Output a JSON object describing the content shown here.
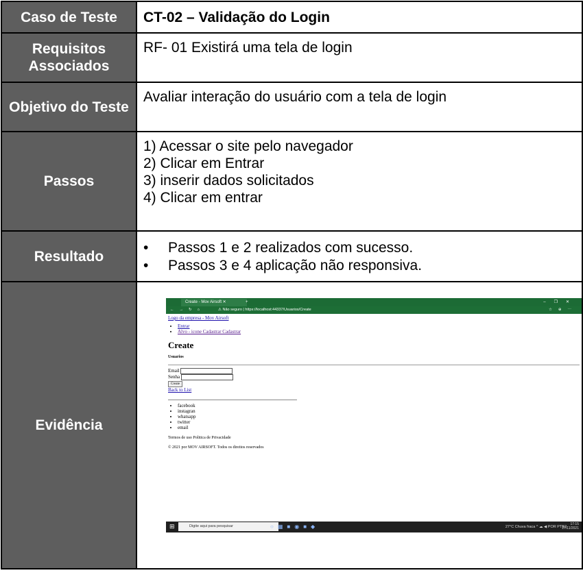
{
  "rows": {
    "caso": {
      "label": "Caso de Teste",
      "value": "CT-02 – Validação do Login"
    },
    "requisitos": {
      "label": "Requisitos Associados",
      "value": "RF- 01 Existirá uma tela de login"
    },
    "objetivo": {
      "label": "Objetivo do Teste",
      "value": "Avaliar interação do usuário com a tela de login"
    },
    "passos": {
      "label": "Passos",
      "steps": [
        "1) Acessar o site pelo navegador",
        "2) Clicar em Entrar",
        "3) inserir dados solicitados",
        "4) Clicar em entrar"
      ]
    },
    "resultado": {
      "label": "Resultado",
      "items": [
        "Passos 1 e 2 realizados com sucesso.",
        "Passos 3 e 4 aplicação não responsiva."
      ]
    },
    "evidencia": {
      "label": "Evidência"
    }
  },
  "screenshot": {
    "browser": {
      "tab_title": "Create - Mov Airsoft",
      "not_secure": "Não seguro",
      "url": "https://localhost:44337/Usuarios/Create",
      "colors": {
        "chrome": "#1c6b35"
      }
    },
    "page": {
      "logo_alt": "Logo da empresa - Mov Airsoft",
      "nav": [
        "Entrar",
        "Alvo - icone Cadastrar Cadastrar"
      ],
      "heading": "Create",
      "subheading": "Usuarios",
      "email_label": "Email",
      "senha_label": "Senha",
      "create_button": "Create",
      "back_link": "Back to List",
      "social": [
        "facebook",
        "instagran",
        "whatsapp",
        "twitter",
        "email"
      ],
      "terms": "Termos de uso Politica de Privacidade",
      "copyright": "© 2021 por MOV AIRSOFT. Todos os direitos reservados"
    },
    "taskbar": {
      "search_placeholder": "Digite aqui para pesquisar",
      "weather": "27°C Chuva fraca",
      "lang": "POR PTB2",
      "time": "17:15",
      "date": "27/11/2021"
    }
  }
}
